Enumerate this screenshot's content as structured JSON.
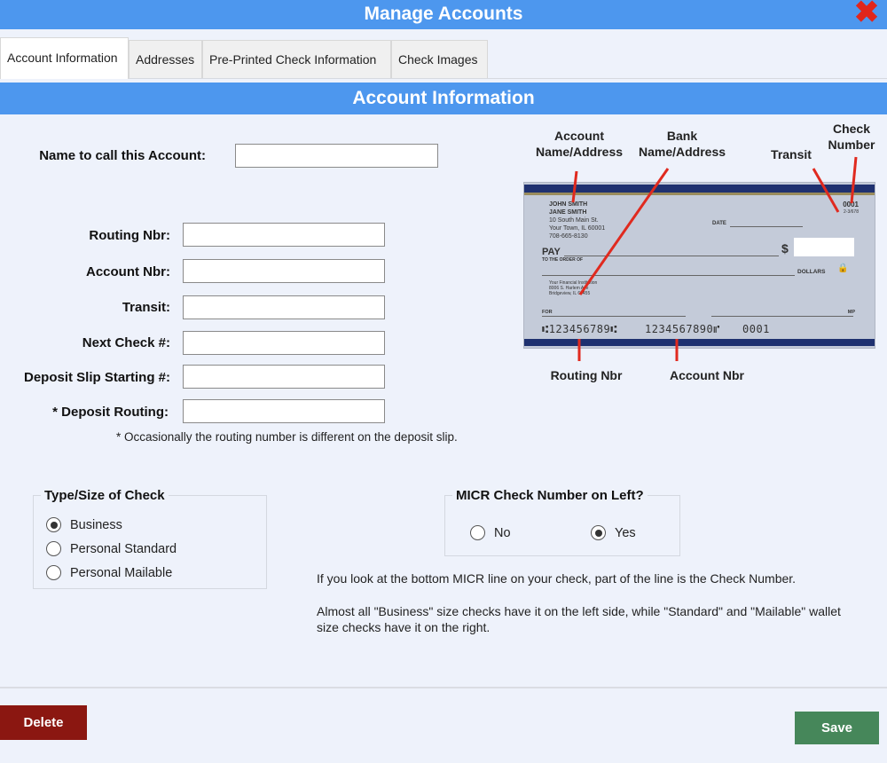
{
  "window": {
    "title": "Manage Accounts",
    "close_icon": "close-x-icon",
    "close_color": "#e0261c"
  },
  "tabs": [
    {
      "label": "Account Information",
      "active": true
    },
    {
      "label": "Addresses",
      "active": false
    },
    {
      "label": "Pre-Printed Check Information",
      "active": false
    },
    {
      "label": "Check Images",
      "active": false
    }
  ],
  "section_title": "Account Information",
  "form": {
    "account_name": {
      "label": "Name to call this Account:",
      "value": ""
    },
    "routing_nbr": {
      "label": "Routing Nbr:",
      "value": ""
    },
    "account_nbr": {
      "label": "Account Nbr:",
      "value": ""
    },
    "transit": {
      "label": "Transit:",
      "value": ""
    },
    "next_check": {
      "label": "Next Check #:",
      "value": ""
    },
    "deposit_slip": {
      "label": "Deposit Slip Starting #:",
      "value": ""
    },
    "deposit_routing": {
      "label": "* Deposit Routing:",
      "value": ""
    },
    "note": "* Occasionally the routing number is different on the deposit slip."
  },
  "check_image": {
    "annotations": {
      "account_name_address": "Account\nName/Address",
      "bank_name_address": "Bank\nName/Address",
      "transit": "Transit",
      "check_number": "Check\nNumber",
      "routing_nbr": "Routing Nbr",
      "account_nbr": "Account Nbr"
    },
    "owner_line1": "JOHN SMITH",
    "owner_line2": "JANE SMITH",
    "owner_line3": "10 South Main St.",
    "owner_line4": "Your Town, IL 60001",
    "owner_line5": "708-665-8130",
    "check_no": "0001",
    "transit_no": "2-3/678",
    "date_label": "DATE",
    "pay_label": "PAY",
    "order_label": "TO THE ORDER OF",
    "dollar_sign": "$",
    "dollars_label": "DOLLARS",
    "bank_line1": "Your Financial Institution",
    "bank_line2": "8006 S. Harlem Ave",
    "bank_line3": "Bridgeview, IL 60455",
    "for_label": "FOR",
    "mp_label": "MP",
    "micr_routing": "⑆123456789⑆",
    "micr_account": "1234567890⑈",
    "micr_check": "0001"
  },
  "check_type": {
    "legend": "Type/Size of Check",
    "options": [
      {
        "label": "Business",
        "checked": true
      },
      {
        "label": "Personal Standard",
        "checked": false
      },
      {
        "label": "Personal Mailable",
        "checked": false
      }
    ]
  },
  "micr_left": {
    "legend": "MICR Check Number on Left?",
    "options": [
      {
        "label": "No",
        "checked": false
      },
      {
        "label": "Yes",
        "checked": true
      }
    ]
  },
  "help": {
    "line1": "If you look at the bottom MICR line on your check, part of the line is the Check Number.",
    "line2": "Almost all \"Business\" size checks have it on the left side, while \"Standard\"  and \"Mailable\" wallet size checks have it on the right."
  },
  "buttons": {
    "delete": {
      "label": "Delete",
      "color": "#8b1711"
    },
    "save": {
      "label": "Save",
      "color": "#46875a"
    }
  },
  "colors": {
    "header_blue": "#4d97ee",
    "background": "#eef2fb",
    "annotation_red": "#e02a1f"
  }
}
